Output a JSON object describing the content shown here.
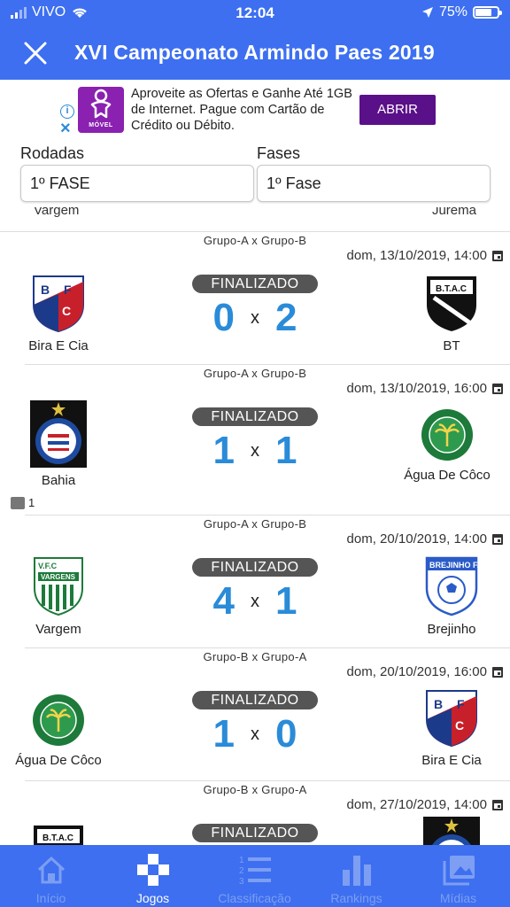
{
  "status_bar": {
    "carrier": "VIVO",
    "time": "12:04",
    "battery": "75%",
    "battery_level": 0.75
  },
  "header": {
    "title": "XVI Campeonato Armindo Paes 2019"
  },
  "ad": {
    "brand": "MÓVEL",
    "text": "Aproveite as Ofertas e Ganhe Até 1GB de Internet. Pague com Cartão de Crédito ou Débito.",
    "button_label": "ABRIR"
  },
  "filters": {
    "rodadas_label": "Rodadas",
    "rodadas_value": "1º FASE",
    "fases_label": "Fases",
    "fases_value": "1º Fase"
  },
  "partial_top": {
    "home": "Vargem",
    "away": "Jurema"
  },
  "matches": [
    {
      "group": "Grupo-A x Grupo-B",
      "date": "dom, 13/10/2019, 14:00",
      "status": "FINALIZADO",
      "home_score": "0",
      "away_score": "2",
      "sep": "x",
      "home": "Bira E Cia",
      "away": "BT"
    },
    {
      "group": "Grupo-A x Grupo-B",
      "date": "dom, 13/10/2019, 16:00",
      "status": "FINALIZADO",
      "home_score": "1",
      "away_score": "1",
      "sep": "x",
      "home": "Bahia",
      "away": "Água De Côco",
      "media_count": "1"
    },
    {
      "group": "Grupo-A x Grupo-B",
      "date": "dom, 20/10/2019, 14:00",
      "status": "FINALIZADO",
      "home_score": "4",
      "away_score": "1",
      "sep": "x",
      "home": "Vargem",
      "away": "Brejinho"
    },
    {
      "group": "Grupo-B x Grupo-A",
      "date": "dom, 20/10/2019, 16:00",
      "status": "FINALIZADO",
      "home_score": "1",
      "away_score": "0",
      "sep": "x",
      "home": "Água De Côco",
      "away": "Bira E Cia"
    },
    {
      "group": "Grupo-B x Grupo-A",
      "date": "dom, 27/10/2019, 14:00",
      "status": "FINALIZADO"
    }
  ],
  "bottom_nav": [
    {
      "label": "Início"
    },
    {
      "label": "Jogos"
    },
    {
      "label": "Classificação"
    },
    {
      "label": "Rankings"
    },
    {
      "label": "Mídias"
    }
  ],
  "colors": {
    "primary": "#3d6ff0",
    "score": "#2a8bd8",
    "ad_button": "#5a1088"
  }
}
